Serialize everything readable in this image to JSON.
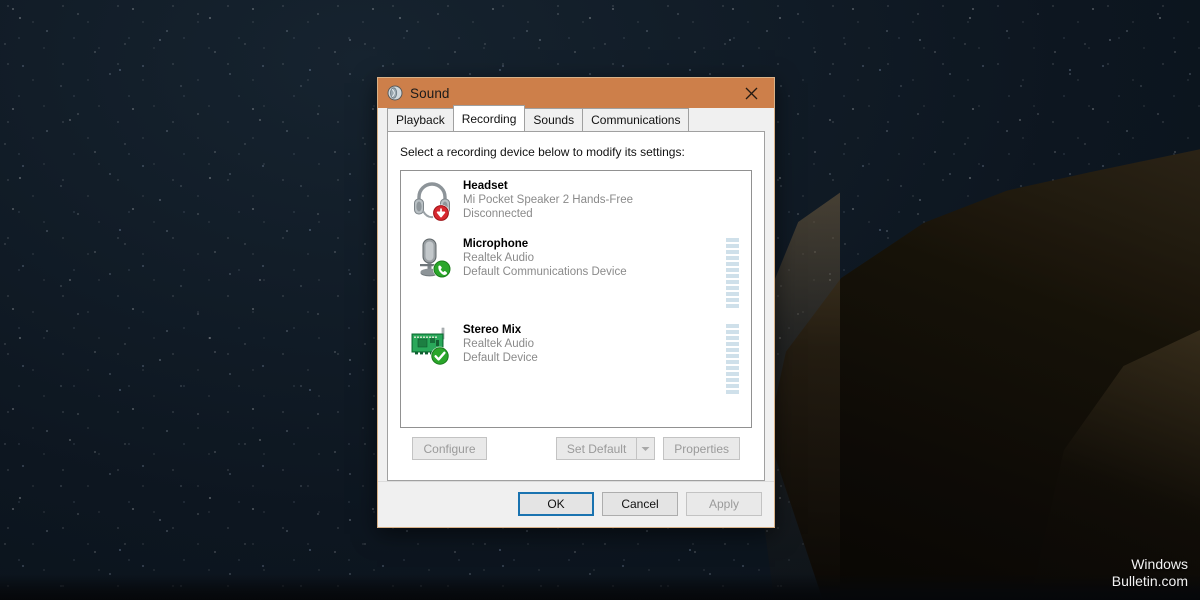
{
  "desktop": {
    "watermark_line1": "Windows",
    "watermark_line2": "Bulletin.com",
    "sky_color": "#0e1822",
    "cliff_color": "#14100a"
  },
  "dialog": {
    "title": "Sound",
    "title_icon": "sound-speaker-icon",
    "titlebar_color": "#cd7f4a",
    "close_icon": "close-icon",
    "tabs": [
      {
        "label": "Playback",
        "active": false
      },
      {
        "label": "Recording",
        "active": true
      },
      {
        "label": "Sounds",
        "active": false
      },
      {
        "label": "Communications",
        "active": false
      }
    ],
    "panel_label": "Select a recording device below to modify its settings:",
    "devices": [
      {
        "name": "Headset",
        "driver": "Mi Pocket Speaker 2 Hands-Free",
        "status": "Disconnected",
        "icon": "headset-icon",
        "badge": "red-down-arrow-badge",
        "has_meter": false,
        "meter_segments": 0
      },
      {
        "name": "Microphone",
        "driver": "Realtek Audio",
        "status": "Default Communications Device",
        "icon": "microphone-icon",
        "badge": "green-phone-badge",
        "has_meter": true,
        "meter_segments": 12
      },
      {
        "name": "Stereo Mix",
        "driver": "Realtek Audio",
        "status": "Default Device",
        "icon": "sound-card-icon",
        "badge": "green-check-badge",
        "has_meter": true,
        "meter_segments": 12
      }
    ],
    "buttons": {
      "configure": "Configure",
      "set_default": "Set Default",
      "set_default_arrow_icon": "chevron-down-icon",
      "properties": "Properties",
      "ok": "OK",
      "cancel": "Cancel",
      "apply": "Apply"
    },
    "accent_focus_color": "#1a73b0"
  }
}
